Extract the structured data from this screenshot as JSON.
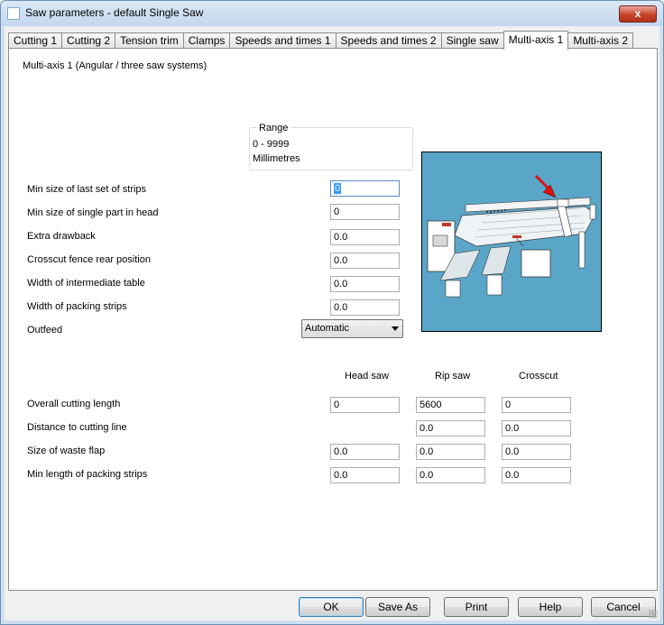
{
  "window": {
    "title": "Saw parameters - default Single Saw",
    "close_glyph": "x"
  },
  "tabs": [
    {
      "label": "Cutting 1",
      "active": false
    },
    {
      "label": "Cutting 2",
      "active": false
    },
    {
      "label": "Tension trim",
      "active": false
    },
    {
      "label": "Clamps",
      "active": false
    },
    {
      "label": "Speeds and times 1",
      "active": false
    },
    {
      "label": "Speeds and times 2",
      "active": false
    },
    {
      "label": "Single saw",
      "active": false
    },
    {
      "label": "Multi-axis 1",
      "active": true
    },
    {
      "label": "Multi-axis 2",
      "active": false
    }
  ],
  "panel": {
    "heading": "Multi-axis 1 (Angular / three saw systems)",
    "range": {
      "title": "Range",
      "values": "0 - 9999",
      "units": "Millimetres"
    },
    "fields": [
      {
        "label": "Min size of last set of strips",
        "value": "0"
      },
      {
        "label": "Min size of single part in head",
        "value": "0"
      },
      {
        "label": "Extra drawback",
        "value": "0.0"
      },
      {
        "label": "Crosscut fence rear position",
        "value": "0.0"
      },
      {
        "label": "Width of intermediate table",
        "value": "0.0"
      },
      {
        "label": "Width of packing strips",
        "value": "0.0"
      }
    ],
    "outfeed": {
      "label": "Outfeed",
      "selected": "Automatic"
    },
    "grid": {
      "columns": [
        "Head saw",
        "Rip saw",
        "Crosscut"
      ],
      "rows": [
        {
          "label": "Overall cutting length",
          "head": "0",
          "rip": "5600",
          "cross": "0"
        },
        {
          "label": "Distance to cutting line",
          "head": null,
          "rip": "0.0",
          "cross": "0.0"
        },
        {
          "label": "Size of waste flap",
          "head": "0.0",
          "rip": "0.0",
          "cross": "0.0"
        },
        {
          "label": "Min length of packing strips",
          "head": "0.0",
          "rip": "0.0",
          "cross": "0.0"
        }
      ]
    },
    "image": {
      "subject": "saw-machine-illustration",
      "accent": "#5aa6c9",
      "arrow_color": "#e01010"
    }
  },
  "buttons": {
    "ok": "OK",
    "save_as": "Save As",
    "print": "Print",
    "help": "Help",
    "cancel": "Cancel"
  }
}
